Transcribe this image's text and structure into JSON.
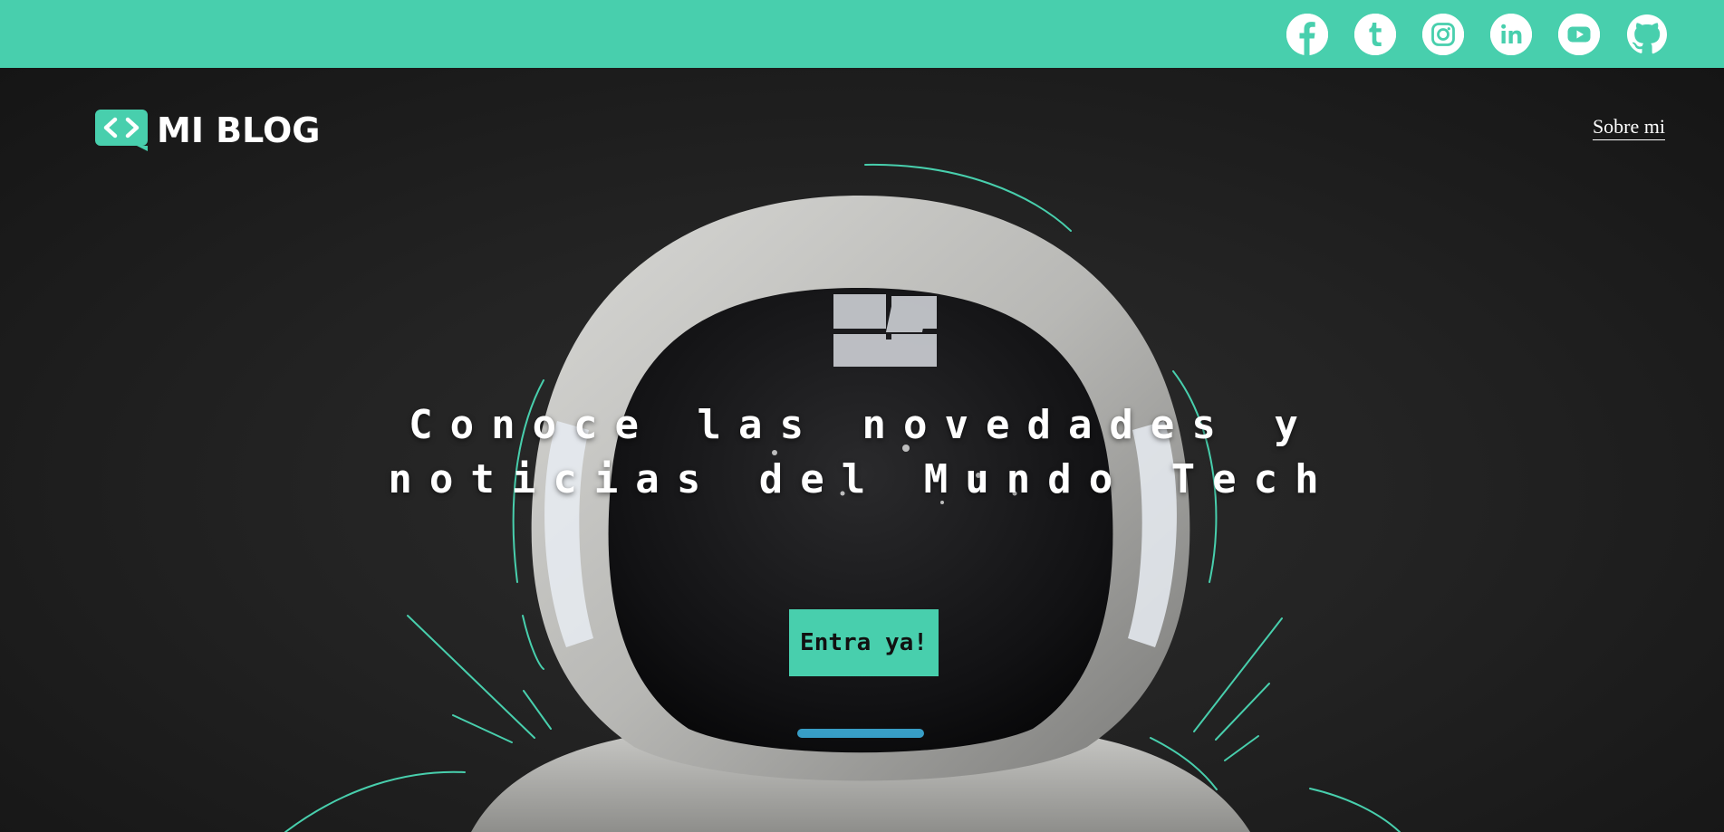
{
  "colors": {
    "accent": "#48cfad",
    "background": "#1b1b1b",
    "text": "#ffffff"
  },
  "social": [
    {
      "name": "facebook",
      "icon": "facebook-icon"
    },
    {
      "name": "tumblr",
      "icon": "tumblr-icon"
    },
    {
      "name": "instagram",
      "icon": "instagram-icon"
    },
    {
      "name": "linkedin",
      "icon": "linkedin-icon"
    },
    {
      "name": "youtube",
      "icon": "youtube-icon"
    },
    {
      "name": "github",
      "icon": "github-icon"
    }
  ],
  "header": {
    "logo_text": "MI BLOG",
    "logo_icon": "code-bubble-icon",
    "nav_link": "Sobre mi"
  },
  "hero": {
    "headline_line1": "Conoce las novedades y",
    "headline_line2": "noticias del Mundo Tech",
    "cta_label": "Entra ya!",
    "background": "astronaut-helmet-photo"
  }
}
